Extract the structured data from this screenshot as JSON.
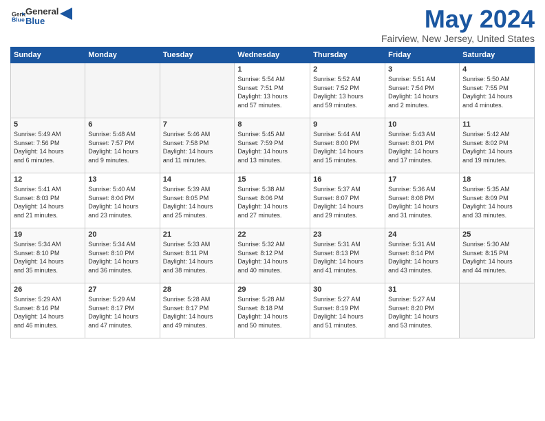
{
  "header": {
    "logo_general": "General",
    "logo_blue": "Blue",
    "month_title": "May 2024",
    "location": "Fairview, New Jersey, United States"
  },
  "days_of_week": [
    "Sunday",
    "Monday",
    "Tuesday",
    "Wednesday",
    "Thursday",
    "Friday",
    "Saturday"
  ],
  "weeks": [
    [
      {
        "day": "",
        "info": ""
      },
      {
        "day": "",
        "info": ""
      },
      {
        "day": "",
        "info": ""
      },
      {
        "day": "1",
        "info": "Sunrise: 5:54 AM\nSunset: 7:51 PM\nDaylight: 13 hours\nand 57 minutes."
      },
      {
        "day": "2",
        "info": "Sunrise: 5:52 AM\nSunset: 7:52 PM\nDaylight: 13 hours\nand 59 minutes."
      },
      {
        "day": "3",
        "info": "Sunrise: 5:51 AM\nSunset: 7:54 PM\nDaylight: 14 hours\nand 2 minutes."
      },
      {
        "day": "4",
        "info": "Sunrise: 5:50 AM\nSunset: 7:55 PM\nDaylight: 14 hours\nand 4 minutes."
      }
    ],
    [
      {
        "day": "5",
        "info": "Sunrise: 5:49 AM\nSunset: 7:56 PM\nDaylight: 14 hours\nand 6 minutes."
      },
      {
        "day": "6",
        "info": "Sunrise: 5:48 AM\nSunset: 7:57 PM\nDaylight: 14 hours\nand 9 minutes."
      },
      {
        "day": "7",
        "info": "Sunrise: 5:46 AM\nSunset: 7:58 PM\nDaylight: 14 hours\nand 11 minutes."
      },
      {
        "day": "8",
        "info": "Sunrise: 5:45 AM\nSunset: 7:59 PM\nDaylight: 14 hours\nand 13 minutes."
      },
      {
        "day": "9",
        "info": "Sunrise: 5:44 AM\nSunset: 8:00 PM\nDaylight: 14 hours\nand 15 minutes."
      },
      {
        "day": "10",
        "info": "Sunrise: 5:43 AM\nSunset: 8:01 PM\nDaylight: 14 hours\nand 17 minutes."
      },
      {
        "day": "11",
        "info": "Sunrise: 5:42 AM\nSunset: 8:02 PM\nDaylight: 14 hours\nand 19 minutes."
      }
    ],
    [
      {
        "day": "12",
        "info": "Sunrise: 5:41 AM\nSunset: 8:03 PM\nDaylight: 14 hours\nand 21 minutes."
      },
      {
        "day": "13",
        "info": "Sunrise: 5:40 AM\nSunset: 8:04 PM\nDaylight: 14 hours\nand 23 minutes."
      },
      {
        "day": "14",
        "info": "Sunrise: 5:39 AM\nSunset: 8:05 PM\nDaylight: 14 hours\nand 25 minutes."
      },
      {
        "day": "15",
        "info": "Sunrise: 5:38 AM\nSunset: 8:06 PM\nDaylight: 14 hours\nand 27 minutes."
      },
      {
        "day": "16",
        "info": "Sunrise: 5:37 AM\nSunset: 8:07 PM\nDaylight: 14 hours\nand 29 minutes."
      },
      {
        "day": "17",
        "info": "Sunrise: 5:36 AM\nSunset: 8:08 PM\nDaylight: 14 hours\nand 31 minutes."
      },
      {
        "day": "18",
        "info": "Sunrise: 5:35 AM\nSunset: 8:09 PM\nDaylight: 14 hours\nand 33 minutes."
      }
    ],
    [
      {
        "day": "19",
        "info": "Sunrise: 5:34 AM\nSunset: 8:10 PM\nDaylight: 14 hours\nand 35 minutes."
      },
      {
        "day": "20",
        "info": "Sunrise: 5:34 AM\nSunset: 8:10 PM\nDaylight: 14 hours\nand 36 minutes."
      },
      {
        "day": "21",
        "info": "Sunrise: 5:33 AM\nSunset: 8:11 PM\nDaylight: 14 hours\nand 38 minutes."
      },
      {
        "day": "22",
        "info": "Sunrise: 5:32 AM\nSunset: 8:12 PM\nDaylight: 14 hours\nand 40 minutes."
      },
      {
        "day": "23",
        "info": "Sunrise: 5:31 AM\nSunset: 8:13 PM\nDaylight: 14 hours\nand 41 minutes."
      },
      {
        "day": "24",
        "info": "Sunrise: 5:31 AM\nSunset: 8:14 PM\nDaylight: 14 hours\nand 43 minutes."
      },
      {
        "day": "25",
        "info": "Sunrise: 5:30 AM\nSunset: 8:15 PM\nDaylight: 14 hours\nand 44 minutes."
      }
    ],
    [
      {
        "day": "26",
        "info": "Sunrise: 5:29 AM\nSunset: 8:16 PM\nDaylight: 14 hours\nand 46 minutes."
      },
      {
        "day": "27",
        "info": "Sunrise: 5:29 AM\nSunset: 8:17 PM\nDaylight: 14 hours\nand 47 minutes."
      },
      {
        "day": "28",
        "info": "Sunrise: 5:28 AM\nSunset: 8:17 PM\nDaylight: 14 hours\nand 49 minutes."
      },
      {
        "day": "29",
        "info": "Sunrise: 5:28 AM\nSunset: 8:18 PM\nDaylight: 14 hours\nand 50 minutes."
      },
      {
        "day": "30",
        "info": "Sunrise: 5:27 AM\nSunset: 8:19 PM\nDaylight: 14 hours\nand 51 minutes."
      },
      {
        "day": "31",
        "info": "Sunrise: 5:27 AM\nSunset: 8:20 PM\nDaylight: 14 hours\nand 53 minutes."
      },
      {
        "day": "",
        "info": ""
      }
    ]
  ]
}
